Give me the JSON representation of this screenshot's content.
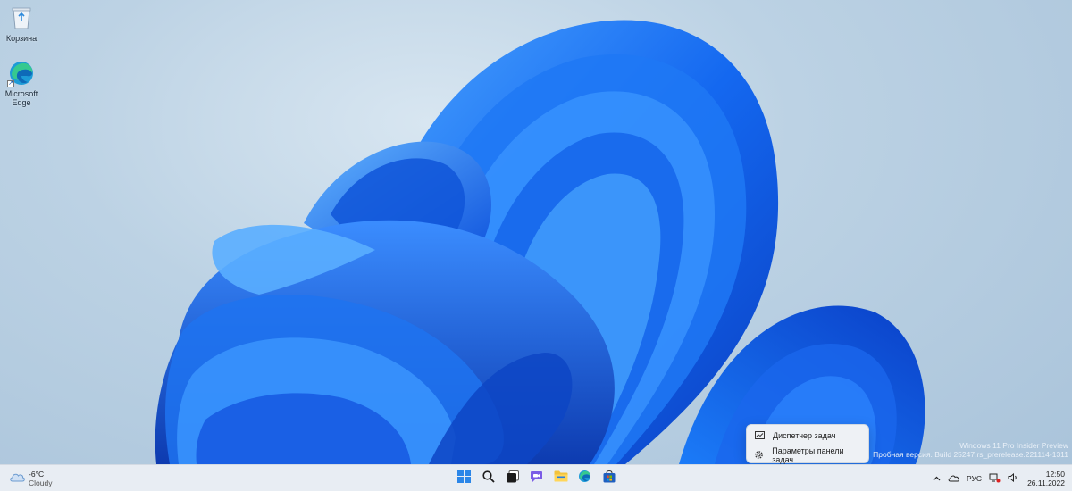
{
  "desktop": {
    "icons": [
      {
        "label": "Корзина",
        "icon": "recycle-bin-icon"
      },
      {
        "label": "Microsoft Edge",
        "icon": "edge-icon"
      }
    ],
    "watermark": {
      "line1": "Windows 11 Pro Insider Preview",
      "line2": "Пробная версия. Build 25247.rs_prerelease.221114-1311"
    }
  },
  "context_menu": {
    "items": [
      {
        "label": "Диспетчер задач",
        "icon": "task-manager-icon"
      },
      {
        "label": "Параметры панели задач",
        "icon": "gear-icon"
      }
    ]
  },
  "taskbar": {
    "weather": {
      "temp": "-6°C",
      "condition": "Cloudy",
      "icon": "cloud-icon"
    },
    "apps": [
      {
        "name": "Start",
        "icon": "windows-start-icon"
      },
      {
        "name": "Search",
        "icon": "search-icon"
      },
      {
        "name": "Task View",
        "icon": "task-view-icon"
      },
      {
        "name": "Chat",
        "icon": "chat-icon"
      },
      {
        "name": "File Explorer",
        "icon": "folder-icon"
      },
      {
        "name": "Microsoft Edge",
        "icon": "edge-icon"
      },
      {
        "name": "Microsoft Store",
        "icon": "store-icon"
      }
    ],
    "tray": {
      "language": "РУС",
      "time": "12:50",
      "date": "26.11.2022"
    }
  },
  "colors": {
    "accent": "#1f6fe5",
    "taskbar_bg": "#e8edf3"
  }
}
